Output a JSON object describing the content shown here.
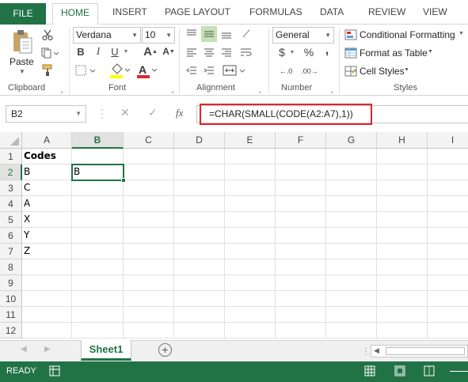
{
  "tabs": {
    "file": "FILE",
    "home": "HOME",
    "insert": "INSERT",
    "page_layout": "PAGE LAYOUT",
    "formulas": "FORMULAS",
    "data": "DATA",
    "review": "REVIEW",
    "view": "VIEW"
  },
  "ribbon": {
    "clipboard": {
      "label": "Clipboard",
      "paste": "Paste"
    },
    "font": {
      "label": "Font",
      "name": "Verdana",
      "size": "10",
      "bold": "B",
      "italic": "I",
      "underline": "U"
    },
    "alignment": {
      "label": "Alignment"
    },
    "number": {
      "label": "Number",
      "format": "General",
      "currency": "$",
      "percent": "%",
      "comma": ","
    },
    "styles": {
      "label": "Styles",
      "conditional": "Conditional Formatting",
      "format_table": "Format as Table",
      "cell_styles": "Cell Styles"
    }
  },
  "formula_bar": {
    "name_box": "B2",
    "fx": "fx",
    "formula": "=CHAR(SMALL(CODE(A2:A7),1))"
  },
  "columns": [
    "A",
    "B",
    "C",
    "D",
    "E",
    "F",
    "G",
    "H",
    "I"
  ],
  "rows": [
    "1",
    "2",
    "3",
    "4",
    "5",
    "6",
    "7",
    "8",
    "9",
    "10",
    "11",
    "12"
  ],
  "cells": {
    "A1": "Codes",
    "A2": "B",
    "A3": "C",
    "A4": "A",
    "A5": "X",
    "A6": "Y",
    "A7": "Z",
    "B2": "B"
  },
  "sheet": {
    "name": "Sheet1"
  },
  "status": {
    "ready": "READY"
  },
  "colors": {
    "accent": "#217346",
    "highlight_border": "#e2252b"
  }
}
